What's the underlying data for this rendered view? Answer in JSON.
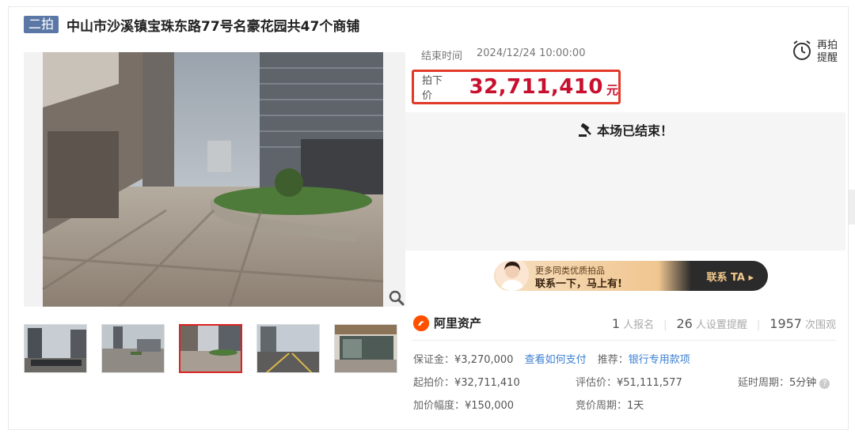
{
  "header": {
    "badge": "二拍",
    "title": "中山市沙溪镇宝珠东路77号名豪花园共47个商铺"
  },
  "auction": {
    "end_label": "结束时间",
    "end_time": "2024/12/24 10:00:00",
    "remind_label": "再拍提醒",
    "price_label": "拍下价",
    "price": "32,711,410",
    "price_unit": "元",
    "status": "本场已结束！"
  },
  "promo": {
    "sub": "更多同类优质拍品",
    "main": "联系一下，马上有!",
    "cta": "联系 TA ▸"
  },
  "brand": {
    "name": "阿里资产"
  },
  "stats": {
    "signups": "1",
    "signups_label": "人报名",
    "reminders": "26",
    "reminders_label": "人设置提醒",
    "views": "1957",
    "views_label": "次围观"
  },
  "details": {
    "deposit_label": "保证金：",
    "deposit": "¥3,270,000",
    "pay_link": "查看如何支付",
    "recommend_label": "推荐：",
    "recommend_link": "银行专用款项",
    "start_price_label": "起拍价：",
    "start_price": "¥32,711,410",
    "appraisal_label": "评估价：",
    "appraisal": "¥51,111,577",
    "delay_label": "延时周期：",
    "delay": "5分钟",
    "increment_label": "加价幅度：",
    "increment": "¥150,000",
    "cycle_label": "竞价周期：",
    "cycle": "1天"
  },
  "colors": {
    "badge": "#5b77a6",
    "price": "#c8102e",
    "price_border": "#e23a2a",
    "link": "#3b7fd1",
    "brand": "#ff5000"
  },
  "icons": {
    "zoom": "magnifier-icon",
    "remind": "alarm-clock-icon",
    "status": "gavel-icon",
    "brand": "alibaba-logo-icon",
    "help": "question-circle-icon"
  },
  "thumbnails": [
    {
      "selected": false
    },
    {
      "selected": false
    },
    {
      "selected": true
    },
    {
      "selected": false
    },
    {
      "selected": false
    }
  ]
}
